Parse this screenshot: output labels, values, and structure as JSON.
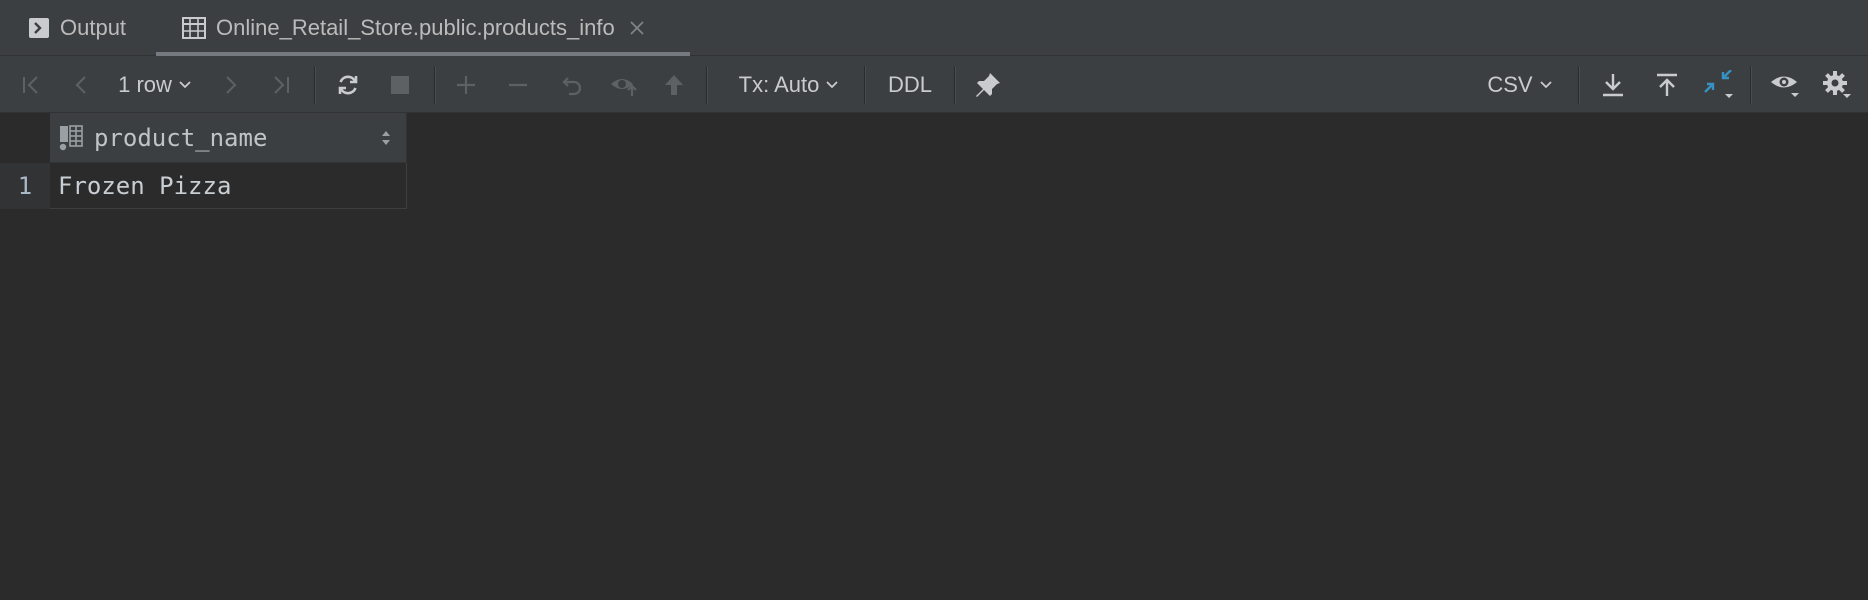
{
  "tabs": [
    {
      "label": "Output",
      "icon": "console-icon"
    },
    {
      "label": "Online_Retail_Store.public.products_info",
      "icon": "table-icon",
      "active": true
    }
  ],
  "toolbar": {
    "row_count_label": "1 row",
    "tx_label": "Tx: Auto",
    "ddl_label": "DDL",
    "export_format_label": "CSV"
  },
  "grid": {
    "columns": [
      "product_name"
    ],
    "rows": [
      {
        "num": "1",
        "cells": [
          "Frozen Pizza"
        ]
      }
    ]
  },
  "colors": {
    "background": "#2b2b2b",
    "panel": "#3c3f41",
    "accent_blue": "#3592c4",
    "text": "#bbbbbb"
  }
}
